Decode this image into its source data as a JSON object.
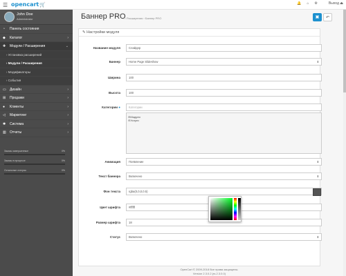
{
  "topbar": {
    "logo": "opencart",
    "logo_cart": "🛒",
    "logout_label": "Выход"
  },
  "user": {
    "name": "John Doe",
    "role": "Administrator"
  },
  "nav": [
    {
      "icon": "tachometer",
      "label": "Панель состояния"
    },
    {
      "icon": "tag",
      "label": "Каталог"
    },
    {
      "icon": "puzzle",
      "label": "Модули / Расширения"
    },
    {
      "label": "Установка расширений"
    },
    {
      "label": "Модули / Расширения"
    },
    {
      "label": "Модификаторы"
    },
    {
      "label": "События"
    },
    {
      "icon": "desktop",
      "label": "Дизайн"
    },
    {
      "icon": "cart",
      "label": "Продажи"
    },
    {
      "icon": "user",
      "label": "Клиенты"
    },
    {
      "icon": "share",
      "label": "Маркетинг"
    },
    {
      "icon": "cog",
      "label": "Система"
    },
    {
      "icon": "chart",
      "label": "Отчеты"
    }
  ],
  "stats": [
    {
      "label": "Заказы завершенные",
      "pct": "0%",
      "value": 0
    },
    {
      "label": "Заказы в процессе",
      "pct": "0%",
      "value": 0
    },
    {
      "label": "Остальные статусы",
      "pct": "0%",
      "value": 0
    }
  ],
  "header": {
    "title": "Баннер PRO",
    "breadcrumb_1": "Расширения",
    "breadcrumb_2": "Баннер PRO"
  },
  "panel": {
    "title": "Настройки модуля"
  },
  "form": {
    "name_label": "Название модуля",
    "name_value": "Слайдер",
    "banner_label": "Баннер",
    "banner_value": "Home Page Slideshow",
    "width_label": "Ширина",
    "width_value": "100",
    "height_label": "Высота",
    "height_value": "100",
    "categories_label": "Категории",
    "categories_placeholder": "Категории",
    "category_items": [
      "Модули",
      "Услуги"
    ],
    "animation_label": "Анимация",
    "animation_value": "Появление",
    "text_label": "Текст баннера",
    "text_value": "Включено",
    "bg_label": "Фон текста",
    "bg_value": "rgba(0,0,0,0.5)",
    "font_label": "Цвет шрифта",
    "font_value": "#ffffff",
    "size_label": "Размер шрифта",
    "size_value": "18",
    "status_label": "Статус",
    "status_value": "Включено"
  },
  "footer": {
    "line1": "OpenCart © 2009-2018 Все права защищены.",
    "line2": "Version 2.3.0.2.(rs.2.3.0.0)"
  }
}
